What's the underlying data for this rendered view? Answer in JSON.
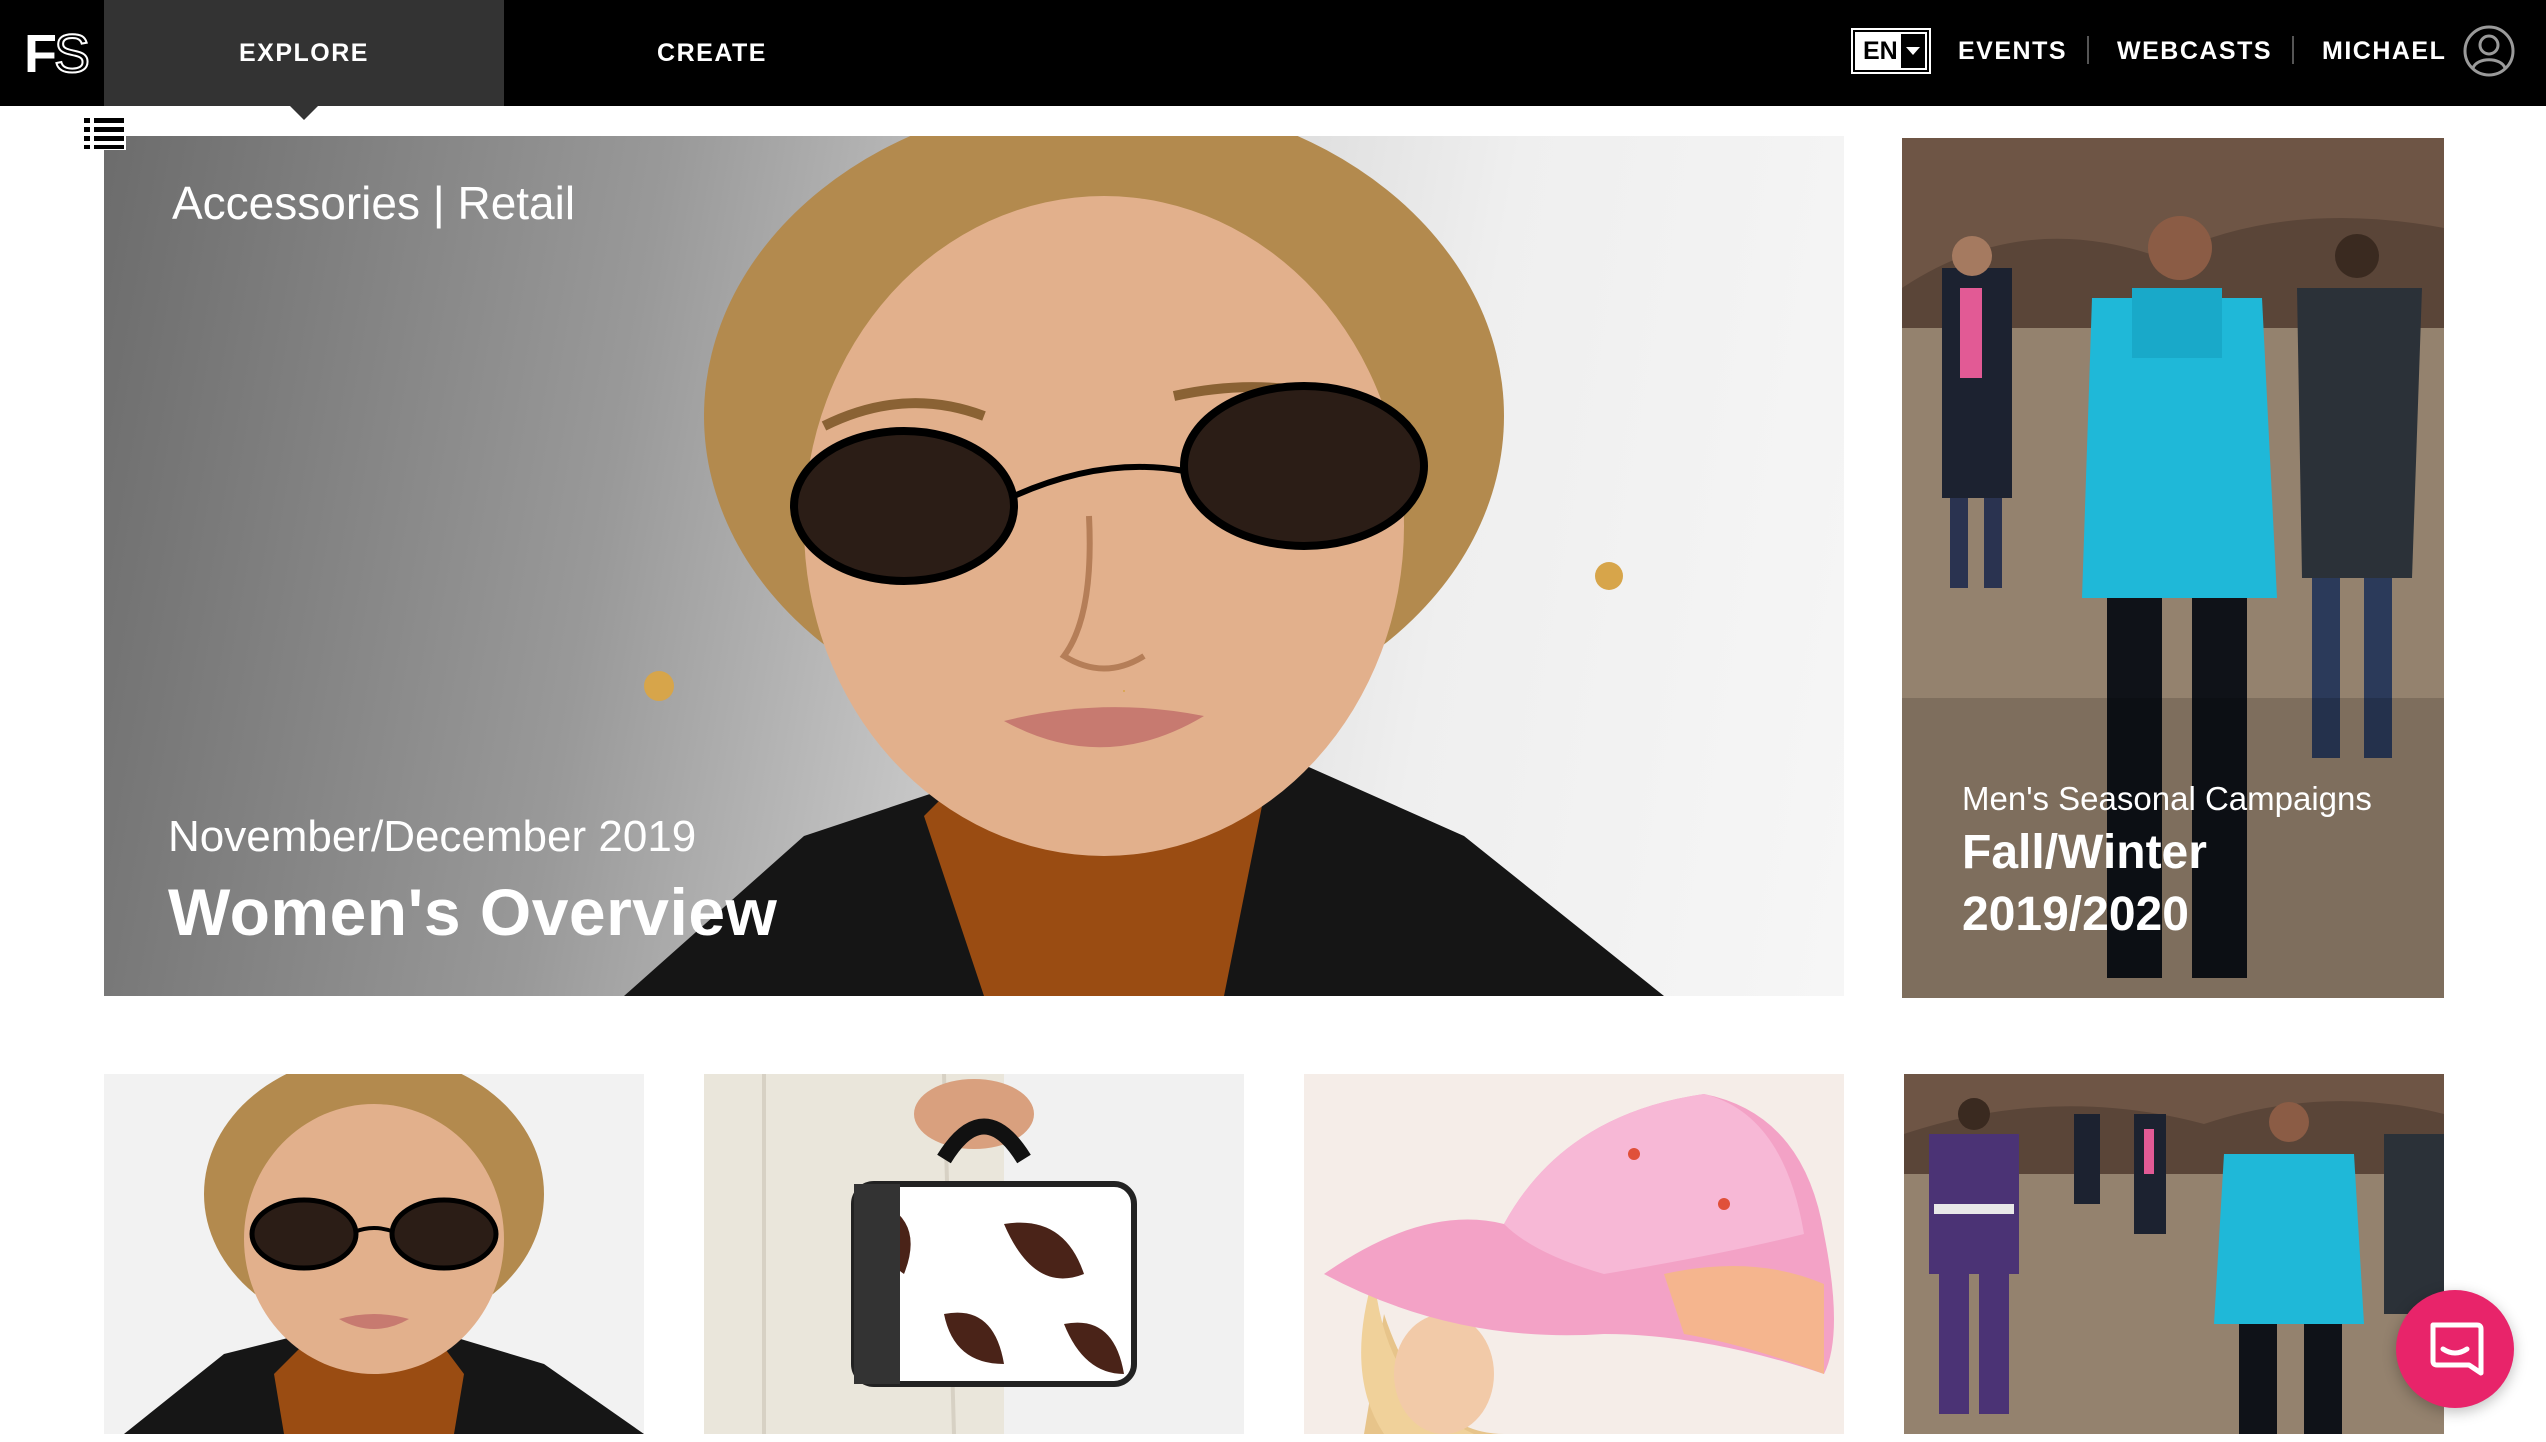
{
  "nav": {
    "logo_text": "FS",
    "tabs": [
      {
        "label": "EXPLORE",
        "active": true
      },
      {
        "label": "CREATE",
        "active": false
      }
    ],
    "language": "EN",
    "links": [
      "EVENTS",
      "WEBCASTS",
      "MICHAEL"
    ],
    "icons": {
      "menu": "list-menu-icon",
      "account": "user-circle-icon",
      "language_toggle": "chevron-down-icon"
    }
  },
  "hero": {
    "category": "Accessories | Retail",
    "date": "November/December 2019",
    "title": "Women's Overview"
  },
  "side_feature": {
    "subtitle": "Men's Seasonal Campaigns",
    "title": "Fall/Winter 2019/2020"
  },
  "thumbnails": [
    {
      "subject": "woman-sunglasses"
    },
    {
      "subject": "cow-print-handbag"
    },
    {
      "subject": "pink-bucket-hat"
    },
    {
      "subject": "men-desert-campaign"
    }
  ],
  "chat": {
    "icon": "chat-bubble-icon",
    "color": "#e8246a"
  }
}
